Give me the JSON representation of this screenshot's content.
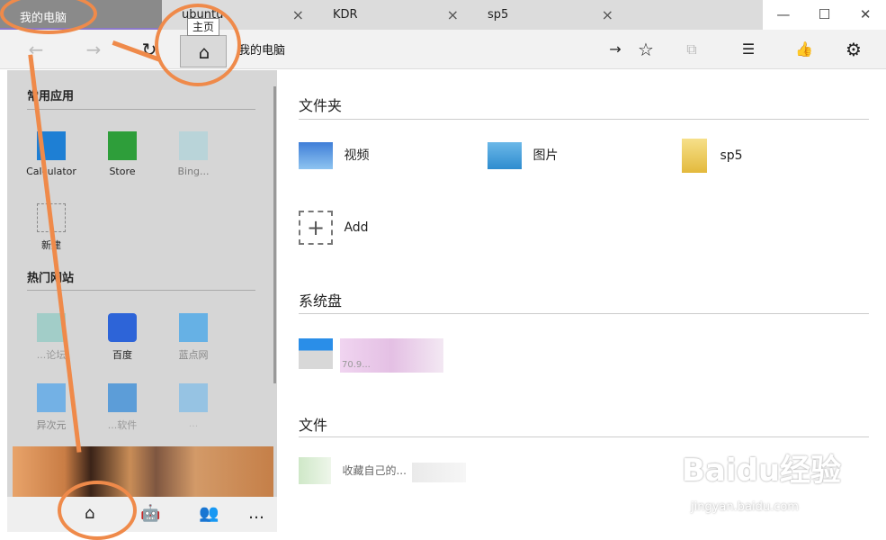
{
  "tabs": [
    {
      "label": "我的电脑",
      "active": true
    },
    {
      "label": "ubuntu",
      "active": false
    },
    {
      "label": "KDR",
      "active": false
    },
    {
      "label": "sp5",
      "active": false
    }
  ],
  "window_controls": {
    "minimize": "—",
    "maximize": "☐",
    "close": "✕"
  },
  "toolbar": {
    "back": "←",
    "forward": "→",
    "refresh": "↻",
    "home": "⌂",
    "home_tooltip": "主页",
    "address": "我的电脑",
    "go": "→",
    "favorite": "☆",
    "share": "⧉",
    "list": "☰",
    "like": "👍",
    "settings": "⚙"
  },
  "left": {
    "common_apps_title": "常用应用",
    "apps": [
      "Calculator",
      "Store",
      "Bing..."
    ],
    "new_label": "新建",
    "hot_sites_title": "热门网站",
    "sites": [
      "...论坛",
      "百度",
      "蓝点网",
      "异次元",
      "...软件",
      "..."
    ],
    "nav": {
      "home": "⌂",
      "robot": "🤖",
      "users": "👥",
      "more": "…"
    }
  },
  "right": {
    "folders_title": "文件夹",
    "folders": [
      "视频",
      "图片",
      "sp5"
    ],
    "add_label": "Add",
    "system_disk_title": "系统盘",
    "disk_size": "70.9...",
    "files_title": "文件",
    "file_name": "收藏自己的..."
  },
  "watermark": {
    "brand": "Baidu经验",
    "url": "jingyan.baidu.com"
  },
  "colors": {
    "accent": "#ef8a4a",
    "tab_active": "#8a8a8a",
    "underline": "#8b78c8"
  }
}
